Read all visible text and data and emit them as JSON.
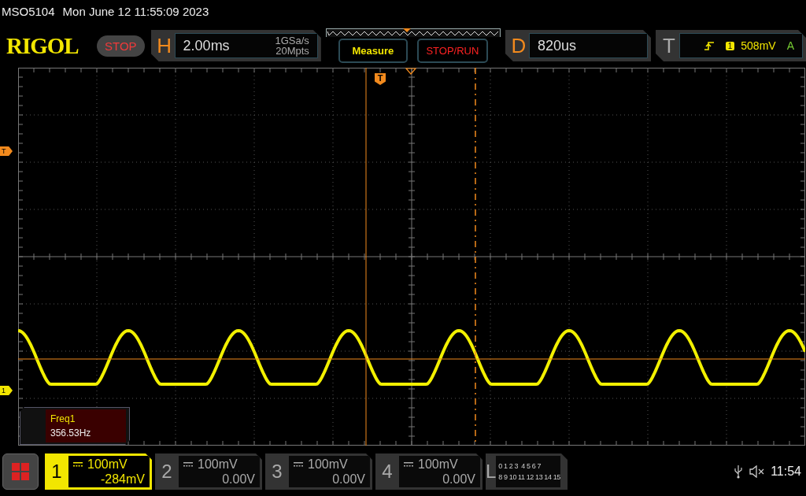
{
  "header": {
    "model": "MSO5104",
    "datetime": "Mon June 12 11:55:09 2023"
  },
  "toolbar": {
    "logo": "RIGOL",
    "run_state": "STOP",
    "horizontal": {
      "label": "H",
      "timebase": "2.00ms",
      "sample_rate": "1GSa/s",
      "memory_depth": "20Mpts"
    },
    "buttons": [
      {
        "label": "Measure",
        "kind": "measure"
      },
      {
        "label": "STOP/RUN",
        "kind": "run"
      }
    ],
    "delay": {
      "label": "D",
      "value": "820us"
    },
    "trigger": {
      "label": "T",
      "source": "1",
      "level": "508mV",
      "mode": "A"
    }
  },
  "display": {
    "trigger_position_flag": "T",
    "trigger_level_marker": "T",
    "channel_marker": "1",
    "measurement": {
      "name": "Freq1",
      "value": "356.53Hz"
    }
  },
  "channels": [
    {
      "number": "1",
      "scale": "100mV",
      "offset": "-284mV",
      "selected": true
    },
    {
      "number": "2",
      "scale": "100mV",
      "offset": "0.00V",
      "selected": false
    },
    {
      "number": "3",
      "scale": "100mV",
      "offset": "0.00V",
      "selected": false
    },
    {
      "number": "4",
      "scale": "100mV",
      "offset": "0.00V",
      "selected": false
    }
  ],
  "logic": {
    "label": "L",
    "bits_low": "0 1 2 3  4 5 6 7",
    "bits_high": "8 9 10 11 12 13 14 15"
  },
  "status": {
    "time": "11:54"
  }
}
